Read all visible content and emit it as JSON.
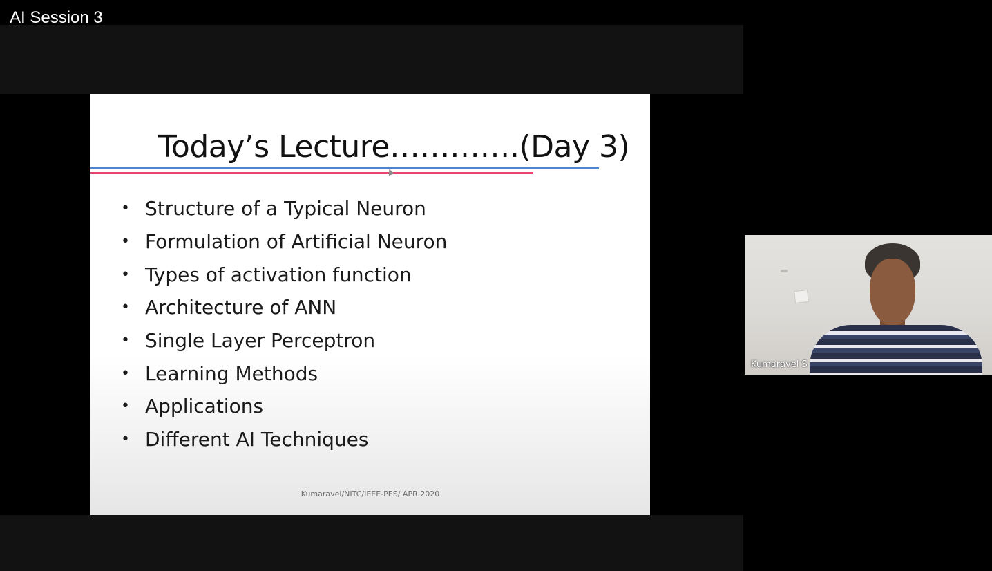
{
  "window": {
    "title": "AI Session 3"
  },
  "slide": {
    "title": "Today’s Lecture………….(Day 3)",
    "bullets": [
      "Structure of a Typical Neuron",
      "Formulation of Artificial Neuron",
      "Types of activation function",
      "Architecture of ANN",
      "Single Layer Perceptron",
      "Learning Methods",
      "Applications",
      "Different AI Techniques"
    ],
    "footer": "Kumaravel/NITC/IEEE-PES/ APR 2020",
    "rule_colors": {
      "top_rule": "#4b86d6",
      "bottom_rule": "#e8466f"
    }
  },
  "participant": {
    "name": "Kumaravel S"
  },
  "colors": {
    "background": "#000000",
    "band": "#121212",
    "slide_background": "#ffffff"
  }
}
